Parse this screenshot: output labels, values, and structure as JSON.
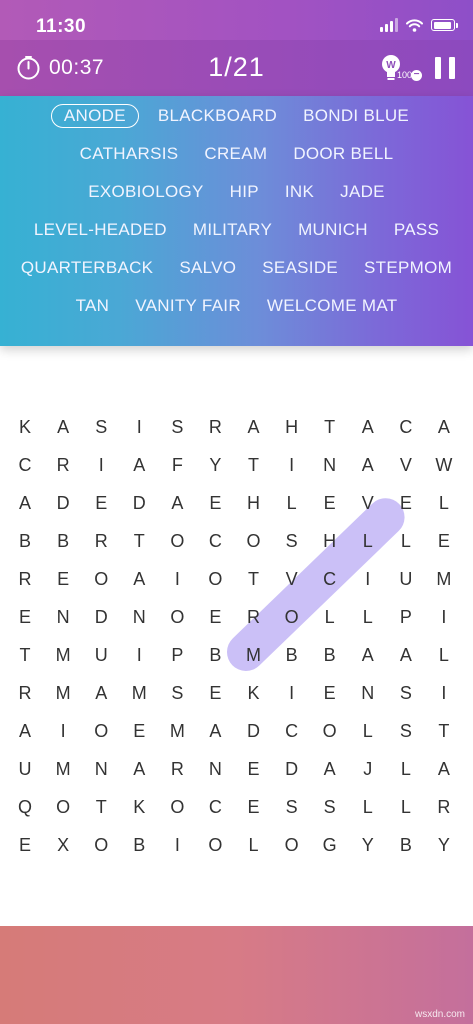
{
  "status": {
    "time": "11:30"
  },
  "header": {
    "timer": "00:37",
    "progress": "1/21",
    "hint_letter": "W",
    "hint_count": "100"
  },
  "words": {
    "rows": [
      [
        "ANODE",
        "BLACKBOARD",
        "BONDI BLUE"
      ],
      [
        "CATHARSIS",
        "CREAM",
        "DOOR BELL"
      ],
      [
        "EXOBIOLOGY",
        "HIP",
        "INK",
        "JADE"
      ],
      [
        "LEVEL-HEADED",
        "MILITARY",
        "MUNICH",
        "PASS"
      ],
      [
        "QUARTERBACK",
        "SALVO",
        "SEASIDE",
        "STEPMOM"
      ],
      [
        "TAN",
        "VANITY FAIR",
        "WELCOME MAT"
      ]
    ],
    "found": [
      "ANODE"
    ]
  },
  "grid": [
    [
      "K",
      "A",
      "S",
      "I",
      "S",
      "R",
      "A",
      "H",
      "T",
      "A",
      "C",
      "A"
    ],
    [
      "C",
      "R",
      "I",
      "A",
      "F",
      "Y",
      "T",
      "I",
      "N",
      "A",
      "V",
      "W"
    ],
    [
      "A",
      "D",
      "E",
      "D",
      "A",
      "E",
      "H",
      "L",
      "E",
      "V",
      "E",
      "L"
    ],
    [
      "B",
      "B",
      "R",
      "T",
      "O",
      "C",
      "O",
      "S",
      "H",
      "L",
      "L",
      "E"
    ],
    [
      "R",
      "E",
      "O",
      "A",
      "I",
      "O",
      "T",
      "V",
      "C",
      "I",
      "U",
      "M"
    ],
    [
      "E",
      "N",
      "D",
      "N",
      "O",
      "E",
      "R",
      "O",
      "L",
      "L",
      "P",
      "I"
    ],
    [
      "T",
      "M",
      "U",
      "I",
      "P",
      "B",
      "M",
      "B",
      "B",
      "A",
      "A",
      "L"
    ],
    [
      "R",
      "M",
      "A",
      "M",
      "S",
      "E",
      "K",
      "I",
      "E",
      "N",
      "S",
      "I"
    ],
    [
      "A",
      "I",
      "O",
      "E",
      "M",
      "A",
      "D",
      "C",
      "O",
      "L",
      "S",
      "T"
    ],
    [
      "U",
      "M",
      "N",
      "A",
      "R",
      "N",
      "E",
      "D",
      "A",
      "J",
      "L",
      "A"
    ],
    [
      "Q",
      "O",
      "T",
      "K",
      "O",
      "C",
      "E",
      "S",
      "S",
      "L",
      "L",
      "R"
    ],
    [
      "E",
      "X",
      "O",
      "B",
      "I",
      "O",
      "L",
      "O",
      "G",
      "Y",
      "B",
      "Y"
    ]
  ],
  "watermark": "wsxdn.com"
}
